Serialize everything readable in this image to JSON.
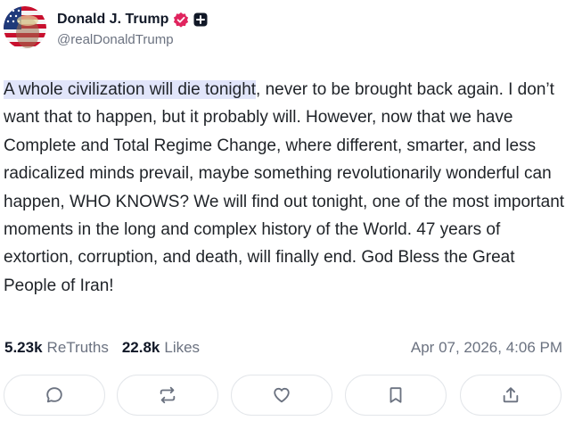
{
  "author": {
    "display_name": "Donald J. Trump",
    "handle": "@realDonaldTrump",
    "avatar_icon": "flag-portrait-avatar",
    "verified_color": "#e0245e"
  },
  "post": {
    "highlighted_text": "A whole civilization will die tonight",
    "text_rest": ", never to be brought back again. I don’t want that to happen, but it probably will. However, now that we have Complete and Total Regime Change, where different, smarter, and less radicalized minds prevail, maybe something revolutionarily wonderful can happen, WHO KNOWS? We will find out tonight, one of the most important moments in the long and complex history of the World. 47 years of extortion, corruption, and death, will finally end. God Bless the Great People of Iran!"
  },
  "stats": {
    "retruths_count": "5.23k",
    "retruths_label": "ReTruths",
    "likes_count": "22.8k",
    "likes_label": "Likes",
    "timestamp": "Apr 07, 2026, 4:06 PM"
  },
  "actions": [
    {
      "name": "reply",
      "icon": "comment-icon"
    },
    {
      "name": "retruth",
      "icon": "repost-icon"
    },
    {
      "name": "like",
      "icon": "heart-icon"
    },
    {
      "name": "bookmark",
      "icon": "bookmark-icon"
    },
    {
      "name": "share",
      "icon": "share-icon"
    }
  ],
  "colors": {
    "highlight": "#e1e5fa",
    "icon_gray": "#6b7280"
  }
}
